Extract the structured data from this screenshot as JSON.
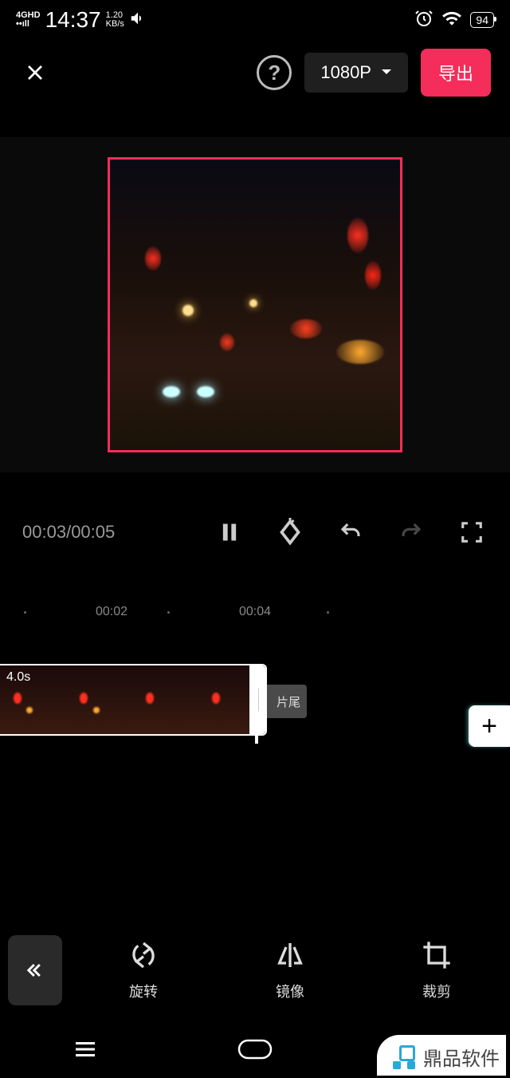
{
  "status": {
    "network": "4GHD",
    "time": "14:37",
    "speed_value": "1.20",
    "speed_unit": "KB/s",
    "battery": "94"
  },
  "topbar": {
    "resolution": "1080P",
    "export": "导出"
  },
  "player": {
    "current": "00:03",
    "total": "00:05"
  },
  "timeline": {
    "marks": [
      "00:02",
      "00:04"
    ],
    "clip_duration": "4.0s",
    "ending": "片尾"
  },
  "tools": {
    "rotate": "旋转",
    "mirror": "镜像",
    "crop": "裁剪"
  },
  "watermark": "鼎品软件"
}
